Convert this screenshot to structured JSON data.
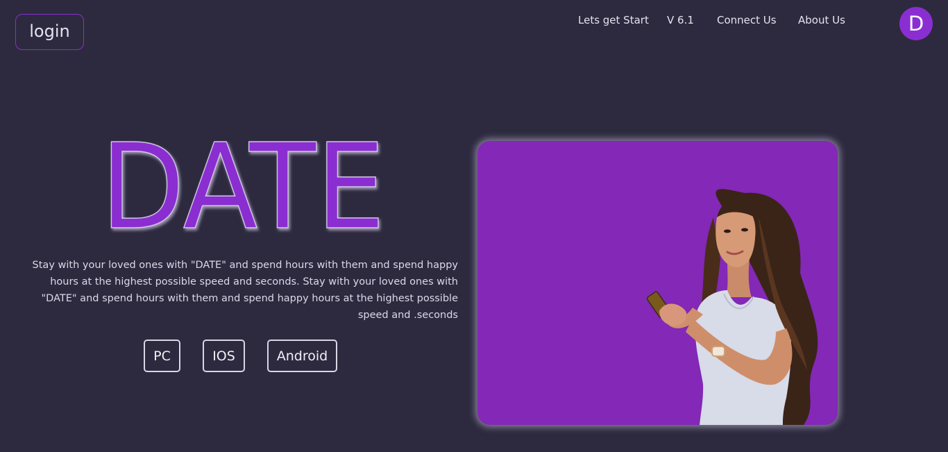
{
  "header": {
    "login_label": "login",
    "nav": [
      {
        "label": "Lets get Start"
      },
      {
        "label": "V 6.1"
      },
      {
        "label": "Connect Us"
      },
      {
        "label": "About Us"
      }
    ],
    "avatar_letter": "D"
  },
  "hero": {
    "title": "DATE",
    "description": "Stay with your loved ones with \"DATE\" and spend hours with them and spend happy hours at the highest possible speed and seconds. Stay with your loved ones with \"DATE\" and spend hours with them and spend happy hours at the highest possible speed and .seconds",
    "platforms": [
      {
        "label": "PC"
      },
      {
        "label": "IOS"
      },
      {
        "label": "Android"
      }
    ],
    "image_subject": "woman-with-phone-illustration"
  },
  "colors": {
    "background": "#2d2a3f",
    "accent": "#8a2ed1",
    "card": "#8328b7",
    "text": "#e6e3ef"
  }
}
